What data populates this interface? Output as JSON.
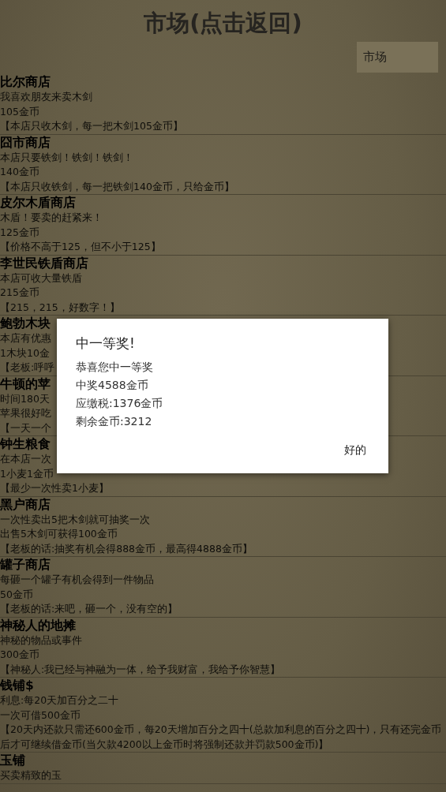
{
  "title": "市场(点击返回)",
  "market_button": "市场",
  "shops": [
    {
      "name": "比尔商店",
      "lines": [
        "我喜欢朋友来卖木剑",
        "105金币",
        "【本店只收木剑，每一把木剑105金币】"
      ]
    },
    {
      "name": "囧市商店",
      "lines": [
        "本店只要铁剑！铁剑！铁剑！",
        "140金币",
        "【本店只收铁剑，每一把铁剑140金币，只给金币】"
      ]
    },
    {
      "name": "皮尔木盾商店",
      "lines": [
        "木盾！要卖的赶紧来！",
        "125金币",
        "【价格不高于125，但不小于125】"
      ]
    },
    {
      "name": "李世民铁盾商店",
      "lines": [
        "本店可收大量铁盾",
        "215金币",
        "【215，215，好数字！】"
      ]
    },
    {
      "name": "鲍勃木块",
      "lines": [
        "本店有优惠",
        "1木块10金",
        "【老板:呼呼"
      ]
    },
    {
      "name": "牛顿的苹",
      "lines": [
        "时间180天",
        "苹果很好吃",
        "【一天一个"
      ]
    },
    {
      "name": "钟生粮食",
      "lines": [
        "在本店一次",
        "1小麦1金币",
        "【最少一次性卖1小麦】"
      ]
    },
    {
      "name": "黑户商店",
      "lines": [
        "一次性卖出5把木剑就可抽奖一次",
        "出售5木剑可获得100金币",
        "【老板的话:抽奖有机会得888金币，最高得4888金币】"
      ]
    },
    {
      "name": "罐子商店",
      "lines": [
        "每砸一个罐子有机会得到一件物品",
        "50金币",
        "【老板的话:来吧，砸一个，没有空的】"
      ]
    },
    {
      "name": "神秘人的地摊",
      "lines": [
        "神秘的物品或事件",
        "300金币",
        "【神秘人:我已经与神融为一体，给予我财富，我给予你智慧】"
      ]
    },
    {
      "name": "钱铺$",
      "lines": [
        "利息:每20天加百分之二十",
        "一次可借500金币",
        "【20天内还款只需还600金币，每20天增加百分之四十(总款加利息的百分之四十)，只有还完金币后才可继续借金币(当欠款4200以上金币时将强制还款并罚款500金币)】"
      ]
    },
    {
      "name": "玉铺",
      "lines": [
        "买卖精致的玉"
      ]
    }
  ],
  "dialog": {
    "title": "中一等奖!",
    "lines": [
      "恭喜您中一等奖",
      "中奖4588金币",
      "应缴税:1376金币",
      "剩余金币:3212"
    ],
    "button": "好的"
  }
}
